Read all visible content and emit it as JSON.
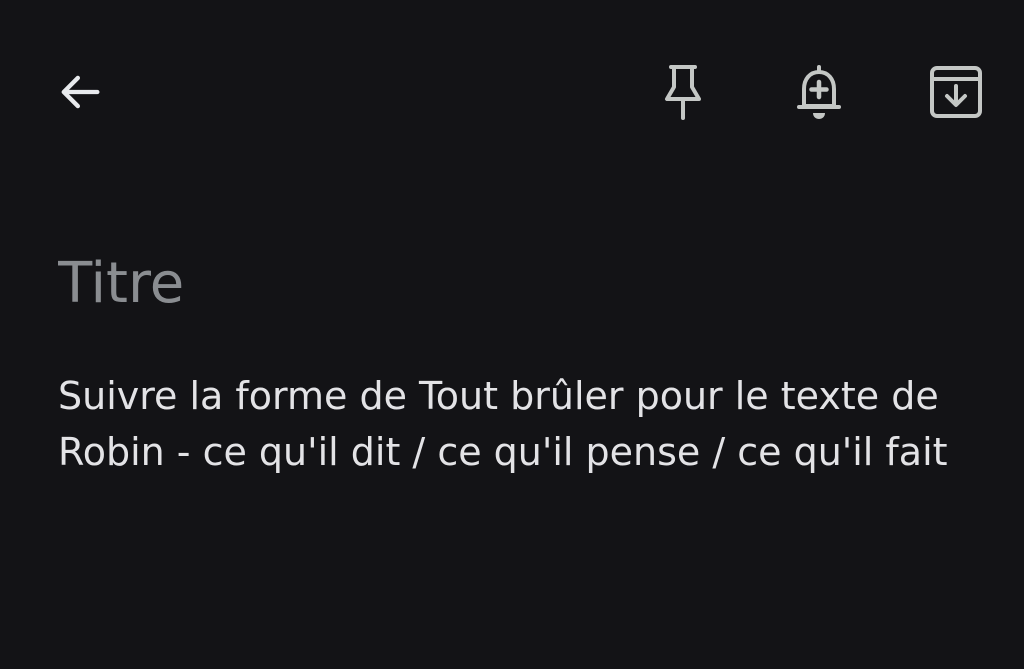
{
  "colors": {
    "background": "#131316",
    "icon": "#c4c7c5",
    "text": "#e3e3e6",
    "placeholder": "#8a8d91"
  },
  "toolbar": {
    "back_icon": "arrow-left-icon",
    "pin_icon": "pin-icon",
    "reminder_icon": "bell-plus-icon",
    "archive_icon": "archive-icon"
  },
  "note": {
    "title_value": "",
    "title_placeholder": "Titre",
    "body": "Suivre la forme de Tout brûler pour le texte de Robin - ce qu'il dit / ce qu'il pense / ce qu'il fait"
  }
}
